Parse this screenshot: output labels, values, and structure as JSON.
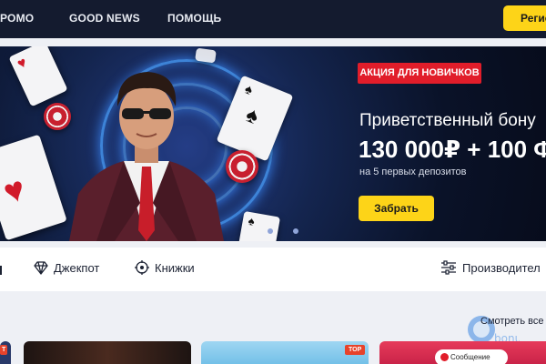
{
  "nav": {
    "items": [
      "РОМО",
      "GOOD NEWS",
      "ПОМОЩЬ"
    ],
    "register_label": "Регис"
  },
  "banner": {
    "badge": "АКЦИЯ ДЛЯ НОВИЧКОВ",
    "title": "Приветственный бону",
    "amount": "130 000₽ + 100 Ф",
    "subtitle": "на 5 первых депозитов",
    "claim_label": "Забрать"
  },
  "categories": {
    "jackpot": "Джекпот",
    "books": "Книжки",
    "providers": "Производител"
  },
  "games": {
    "see_all": "Смотреть все",
    "top_badge": "TOP",
    "message_label": "Сообщение",
    "watermark_text": "bonus"
  },
  "colors": {
    "nav_bg": "#141b2f",
    "accent_yellow": "#fdd418",
    "promo_red": "#e11d2a",
    "banner_bg": "#0a1228"
  }
}
